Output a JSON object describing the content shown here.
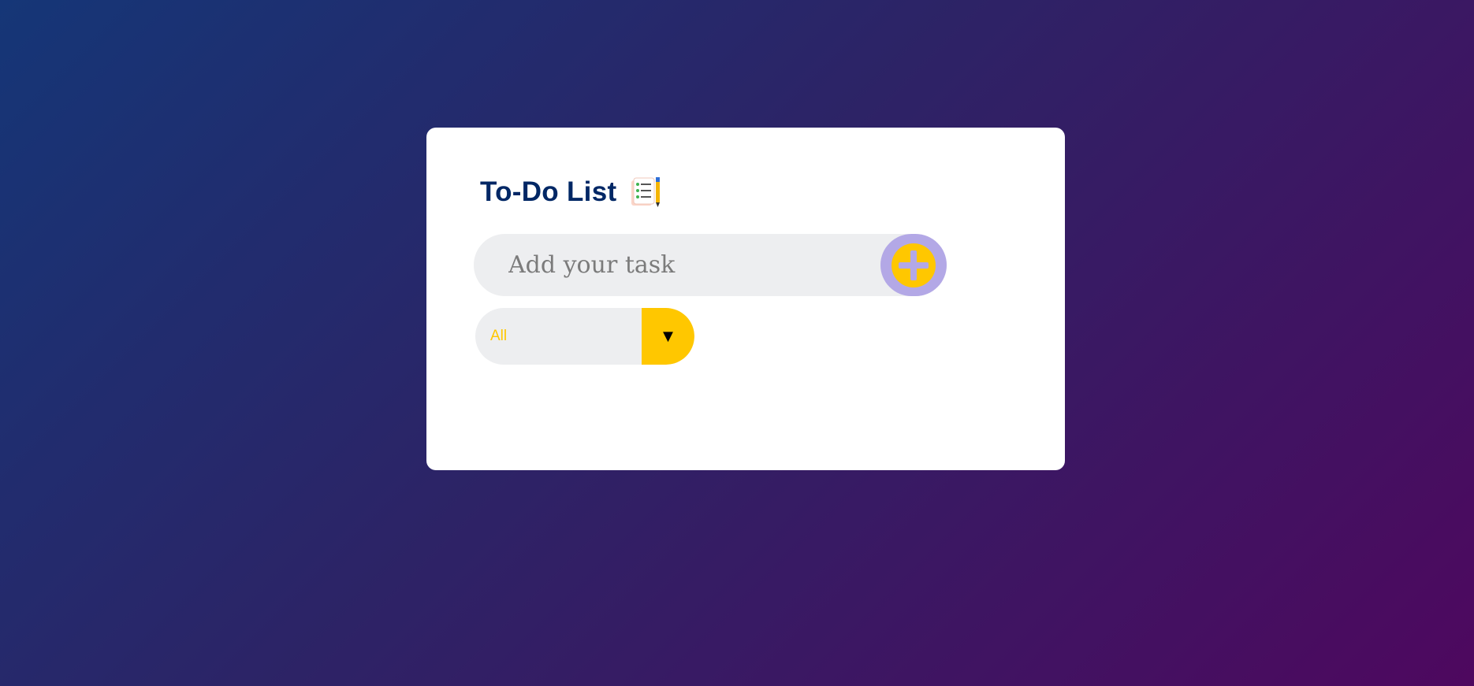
{
  "app": {
    "title": "To-Do List",
    "title_icon": "notepad-checklist-pencil-icon"
  },
  "task_input": {
    "value": "",
    "placeholder": "Add your task"
  },
  "add_button": {
    "icon": "plus-icon",
    "color": "#ffc700",
    "ring_color": "#b3a8e6"
  },
  "filter": {
    "selected": "All",
    "arrow": "▼",
    "accent": "#ffc700"
  },
  "theme": {
    "background_start": "#153677",
    "background_end": "#4e085f",
    "title_color": "#002765"
  }
}
